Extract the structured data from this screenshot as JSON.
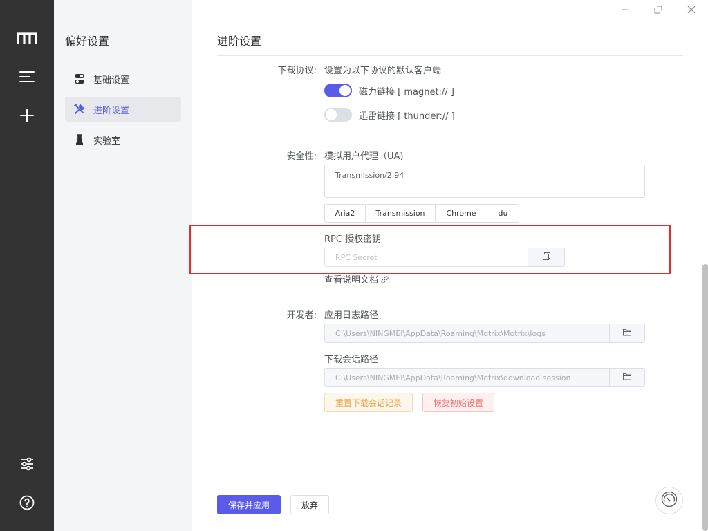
{
  "sidebar": {
    "title": "偏好设置",
    "items": [
      {
        "label": "基础设置",
        "icon": "toggle-icon"
      },
      {
        "label": "进阶设置",
        "icon": "tools-icon"
      },
      {
        "label": "实验室",
        "icon": "flask-icon"
      }
    ]
  },
  "main": {
    "title": "进阶设置",
    "protocol": {
      "label": "下载协议:",
      "desc": "设置为以下协议的默认客户端",
      "magnet": "磁力链接 [ magnet:// ]",
      "magnet_on": true,
      "thunder": "迅雷链接 [ thunder:// ]",
      "thunder_on": false
    },
    "security": {
      "label": "安全性:",
      "ua_title": "模拟用户代理（UA)",
      "ua_value": "Transmission/2.94",
      "ua_presets": [
        "Aria2",
        "Transmission",
        "Chrome",
        "du"
      ],
      "rpc_title": "RPC 授权密钥",
      "rpc_placeholder": "RPC Secret",
      "doc_link": "查看说明文档"
    },
    "developer": {
      "label": "开发者:",
      "log_title": "应用日志路径",
      "log_path": "C:\\Users\\NINGMEI\\AppData\\Roaming\\Motrix\\Motrix\\logs",
      "session_title": "下载会话路径",
      "session_path": "C:\\Users\\NINGMEI\\AppData\\Roaming\\Motrix\\download.session",
      "reset_session": "重置下载会话记录",
      "factory_reset": "恢复初始设置"
    },
    "footer": {
      "save": "保存并应用",
      "discard": "放弃"
    }
  },
  "colors": {
    "accent": "#5b5bea",
    "rail": "#333333",
    "sidebar": "#f4f5f7",
    "highlight": "#e62b2b",
    "warning": "#e6a23c",
    "danger": "#f56c6c"
  }
}
